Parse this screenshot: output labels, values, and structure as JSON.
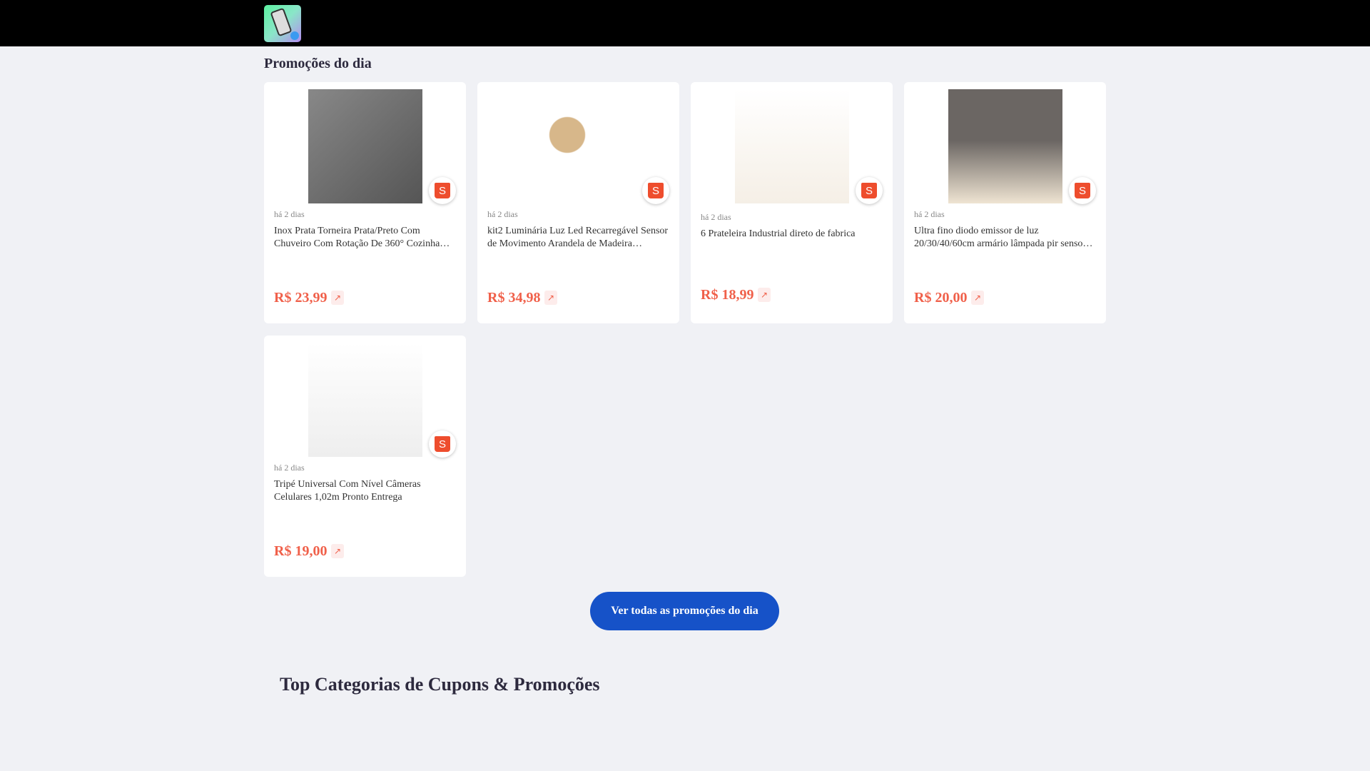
{
  "header": {
    "logo_icon": "app-logo"
  },
  "section_title": "Promoções do dia",
  "products": [
    {
      "date": "há 2 dias",
      "name": "Inox Prata Torneira Prata/Preto Com Chuveiro Com Rotação De 360° Cozinha Banheiro",
      "price": "R$ 23,99",
      "store_icon": "shopee-icon"
    },
    {
      "date": "há 2 dias",
      "name": "kit2 Luminária Luz Led Recarregável Sensor de Movimento Arandela de Madeira Magnética",
      "price": "R$ 34,98",
      "store_icon": "shopee-icon"
    },
    {
      "date": "há 2 dias",
      "name": "6 Prateleira Industrial direto de fabrica",
      "price": "R$ 18,99",
      "store_icon": "shopee-icon"
    },
    {
      "date": "há 2 dias",
      "name": "Ultra fino diodo emissor de luz 20/30/40/60cm armário lâmpada pir sensor de movimento",
      "price": "R$ 20,00",
      "store_icon": "shopee-icon"
    },
    {
      "date": "há 2 dias",
      "name": "Tripé Universal Com Nível Câmeras Celulares 1,02m Pronto Entrega",
      "price": "R$ 19,00",
      "store_icon": "shopee-icon"
    }
  ],
  "view_all_label": "Ver todas as promoções do dia",
  "categories_title": "Top Categorias de Cupons & Promoções",
  "colors": {
    "accent": "#1652c8",
    "price": "#f0604a",
    "shopee": "#ee4d2d"
  }
}
